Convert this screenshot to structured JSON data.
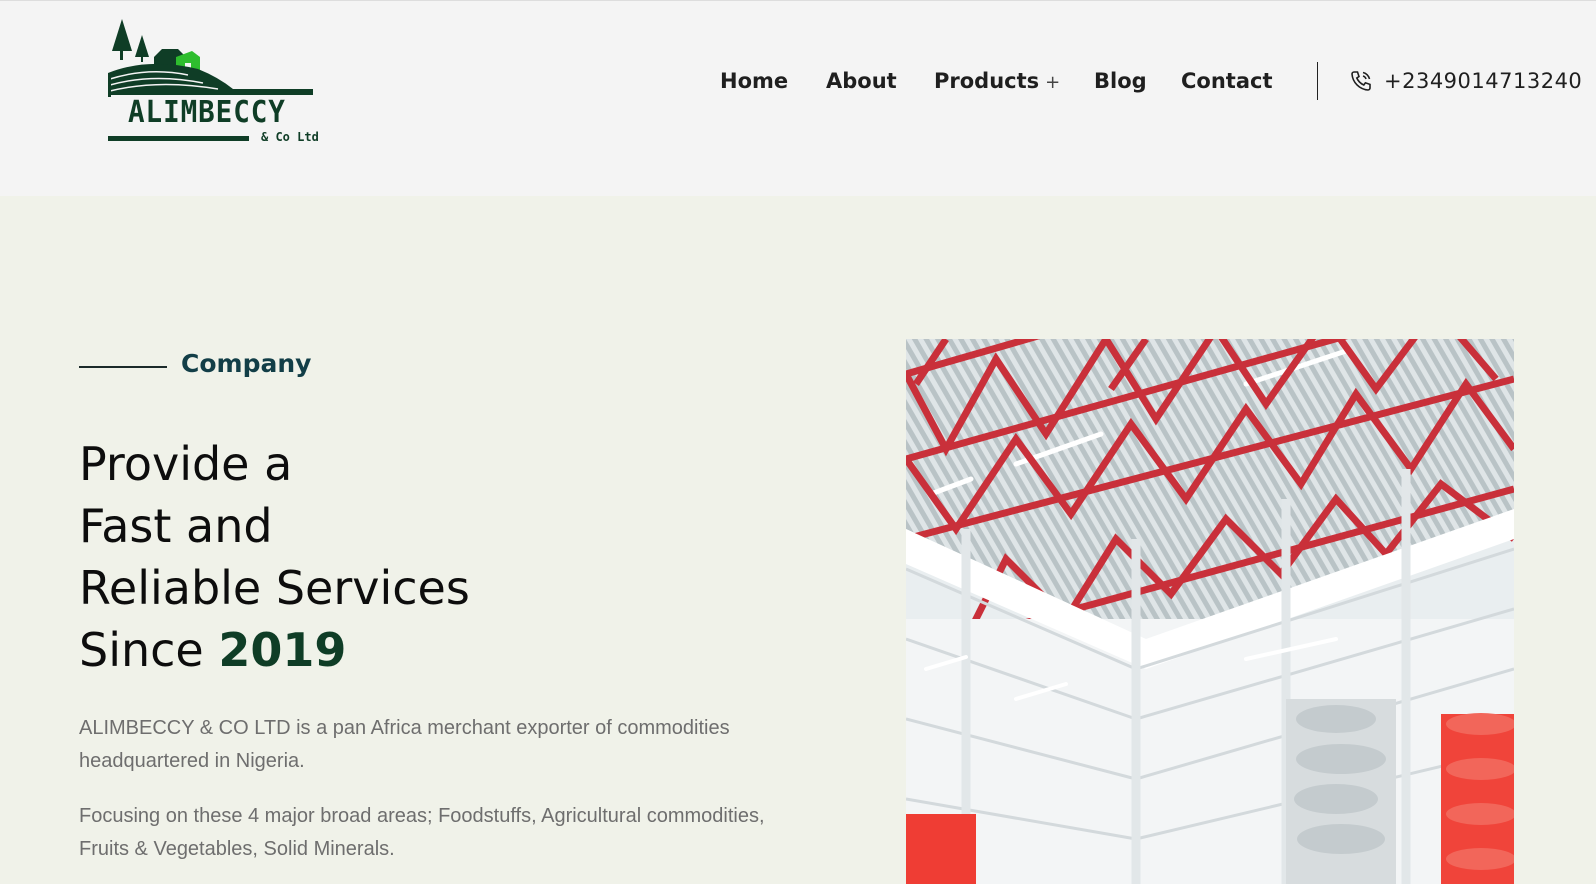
{
  "header": {
    "logo": {
      "name": "ALIMBECCY",
      "sub": "& Co Ltd"
    },
    "nav": [
      {
        "label": "Home"
      },
      {
        "label": "About"
      },
      {
        "label": "Products",
        "expand": "+"
      },
      {
        "label": "Blog"
      },
      {
        "label": "Contact"
      }
    ],
    "phone": "+2349014713240"
  },
  "hero": {
    "kicker": "Company",
    "heading_lines": [
      "Provide a",
      "Fast and",
      "Reliable Services"
    ],
    "heading_last_prefix": "Since ",
    "heading_year": "2019",
    "paragraphs": [
      "ALIMBECCY & CO LTD is a pan Africa merchant exporter of commodities headquartered in Nigeria.",
      "Focusing on these 4 major broad areas; Foodstuffs, Agricultural commodities, Fruits & Vegetables, Solid Minerals."
    ]
  },
  "colors": {
    "brand_green": "#0f3d26",
    "logo_accent_green": "#2ebd2e",
    "kicker_color": "#123e47",
    "page_bg": "#f0f2e9",
    "header_bg": "#f4f4f4"
  },
  "icons": {
    "phone": "phone-icon"
  }
}
